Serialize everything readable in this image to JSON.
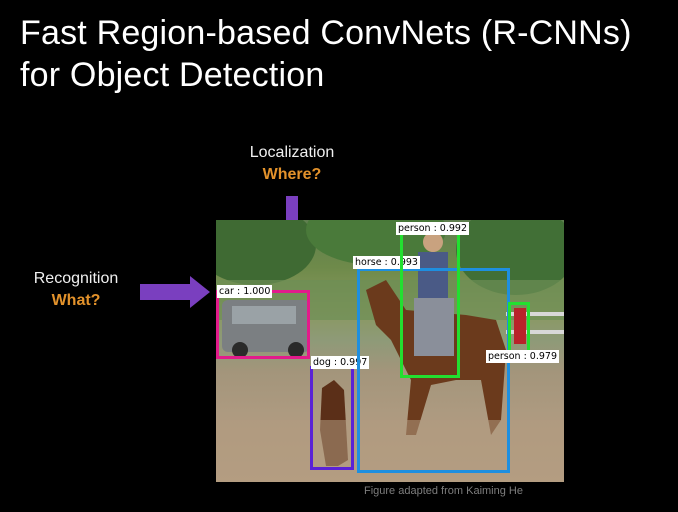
{
  "title": {
    "line1": "Fast Region-based ConvNets (R-CNNs)",
    "line2": "for Object Detection"
  },
  "localization": {
    "label": "Localization",
    "question": "Where?"
  },
  "recognition": {
    "label": "Recognition",
    "question": "What?"
  },
  "detections": [
    {
      "label": "car : 1.000",
      "color": "#e21b8b"
    },
    {
      "label": "dog : 0.997",
      "color": "#5a22d6"
    },
    {
      "label": "horse : 0.993",
      "color": "#1e8fe0"
    },
    {
      "label": "person : 0.992",
      "color": "#22e030"
    },
    {
      "label": "person : 0.979",
      "color": "#22e030"
    }
  ],
  "credit": "Figure adapted from Kaiming He",
  "colors": {
    "accent": "#e3922b",
    "arrow": "#7a3fbf"
  }
}
